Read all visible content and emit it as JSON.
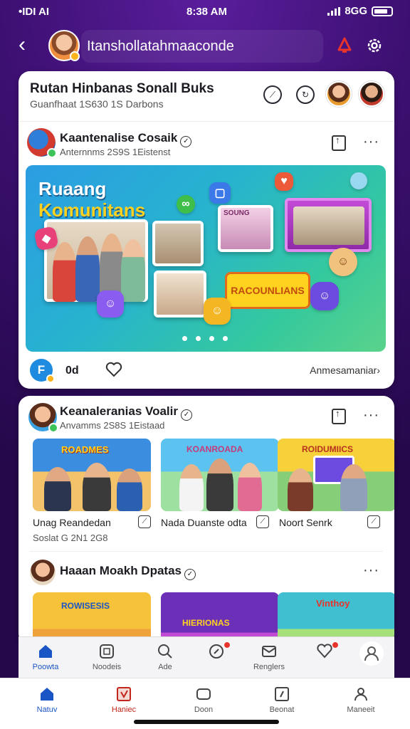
{
  "status": {
    "left": "•IDI AI",
    "time": "8:38 AM",
    "right": "8GG"
  },
  "header": {
    "title": "Itanshollatahmaaconde",
    "back_icon": "chevron-left-icon",
    "alert_icon": "bell-icon",
    "settings_icon": "gear-icon"
  },
  "group": {
    "title": "Rutan Hinbanas Sonall Buks",
    "subtitle": "Guanfhaat 1S630 1S Darbons"
  },
  "post1": {
    "title": "Kaantenalise Cosaik",
    "subtitle": "Anternnms 2S9S 1Eistenst",
    "banner": {
      "line1": "Ruaang",
      "line2": "Komunitans",
      "ribbon": "RACOUNLIANS",
      "photo_caption": "SOUNG"
    },
    "reaction_count": "0d",
    "action_text": "Anmesamaniar›"
  },
  "post2": {
    "title": "Keanaleranias Voalir",
    "subtitle": "Anvamms 2S8S 1Eistaad",
    "thumbs": [
      {
        "caption": "Unag Reandedan",
        "sign": "ROADMES"
      },
      {
        "caption": "Nada Duanste odta",
        "sign": "KOANROADA"
      },
      {
        "caption": "Noort Senrk",
        "sign": "ROIDUMIICS"
      }
    ],
    "meta": "Soslat G 2N1 2G8"
  },
  "post3": {
    "title": "Haaan Moakh Dpatas",
    "thumb_signs": [
      "ROWISESIS",
      "HIERIONAS",
      "Vinthoy"
    ]
  },
  "inner_tabs": [
    {
      "label": "Poowta",
      "icon": "home-icon",
      "active": true
    },
    {
      "label": "Noodeis",
      "icon": "grid-icon",
      "active": false
    },
    {
      "label": "Ade",
      "icon": "search-icon",
      "active": false
    },
    {
      "label": "",
      "icon": "compass-icon",
      "active": false,
      "badge": true
    },
    {
      "label": "Renglers",
      "icon": "inbox-icon",
      "active": false
    },
    {
      "label": "",
      "icon": "heart-shield-icon",
      "active": false,
      "badge": true
    },
    {
      "label": "",
      "icon": "person-icon",
      "active": false
    }
  ],
  "bottom_tabs": [
    {
      "label": "Natuv",
      "icon": "home-icon",
      "active": true
    },
    {
      "label": "Haniec",
      "icon": "calendar-icon",
      "active": false
    },
    {
      "label": "Doon",
      "icon": "chat-icon",
      "active": false
    },
    {
      "label": "Beonat",
      "icon": "flag-icon",
      "active": false
    },
    {
      "label": "Maneeit",
      "icon": "person-icon",
      "active": false
    }
  ],
  "colors": {
    "accent": "#1a55c5",
    "bg": "#3a0f6e",
    "badge": "#e8342b"
  }
}
